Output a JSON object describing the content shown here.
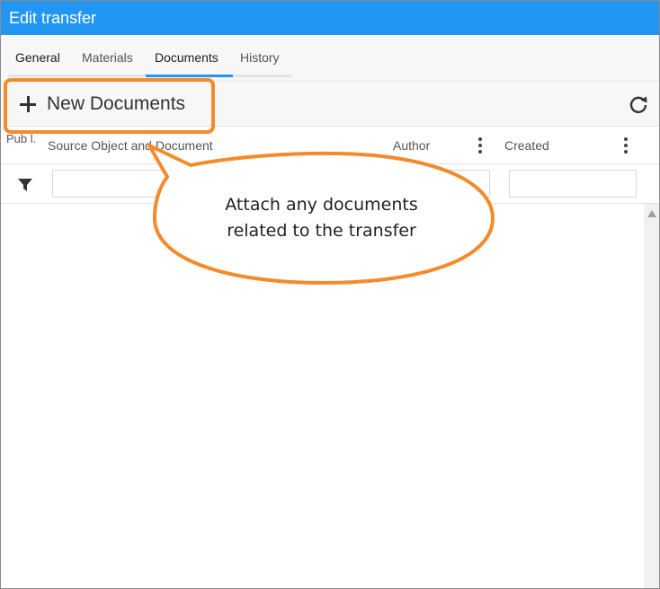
{
  "window": {
    "title": "Edit transfer"
  },
  "tabs": [
    {
      "label": "General"
    },
    {
      "label": "Materials"
    },
    {
      "label": "Documents"
    },
    {
      "label": "History"
    }
  ],
  "active_tab": "Documents",
  "toolbar": {
    "new_label": "New Documents"
  },
  "table": {
    "columns": [
      {
        "label": "Pub l."
      },
      {
        "label": "Source Object and Document"
      },
      {
        "label": "Author"
      },
      {
        "label": "Created"
      }
    ],
    "rows": []
  },
  "callout": {
    "line1": "Attach any documents",
    "line2": "related to the transfer",
    "color": "#f58a2a"
  },
  "colors": {
    "accent": "#2196f3",
    "highlight": "#f58a2a"
  }
}
